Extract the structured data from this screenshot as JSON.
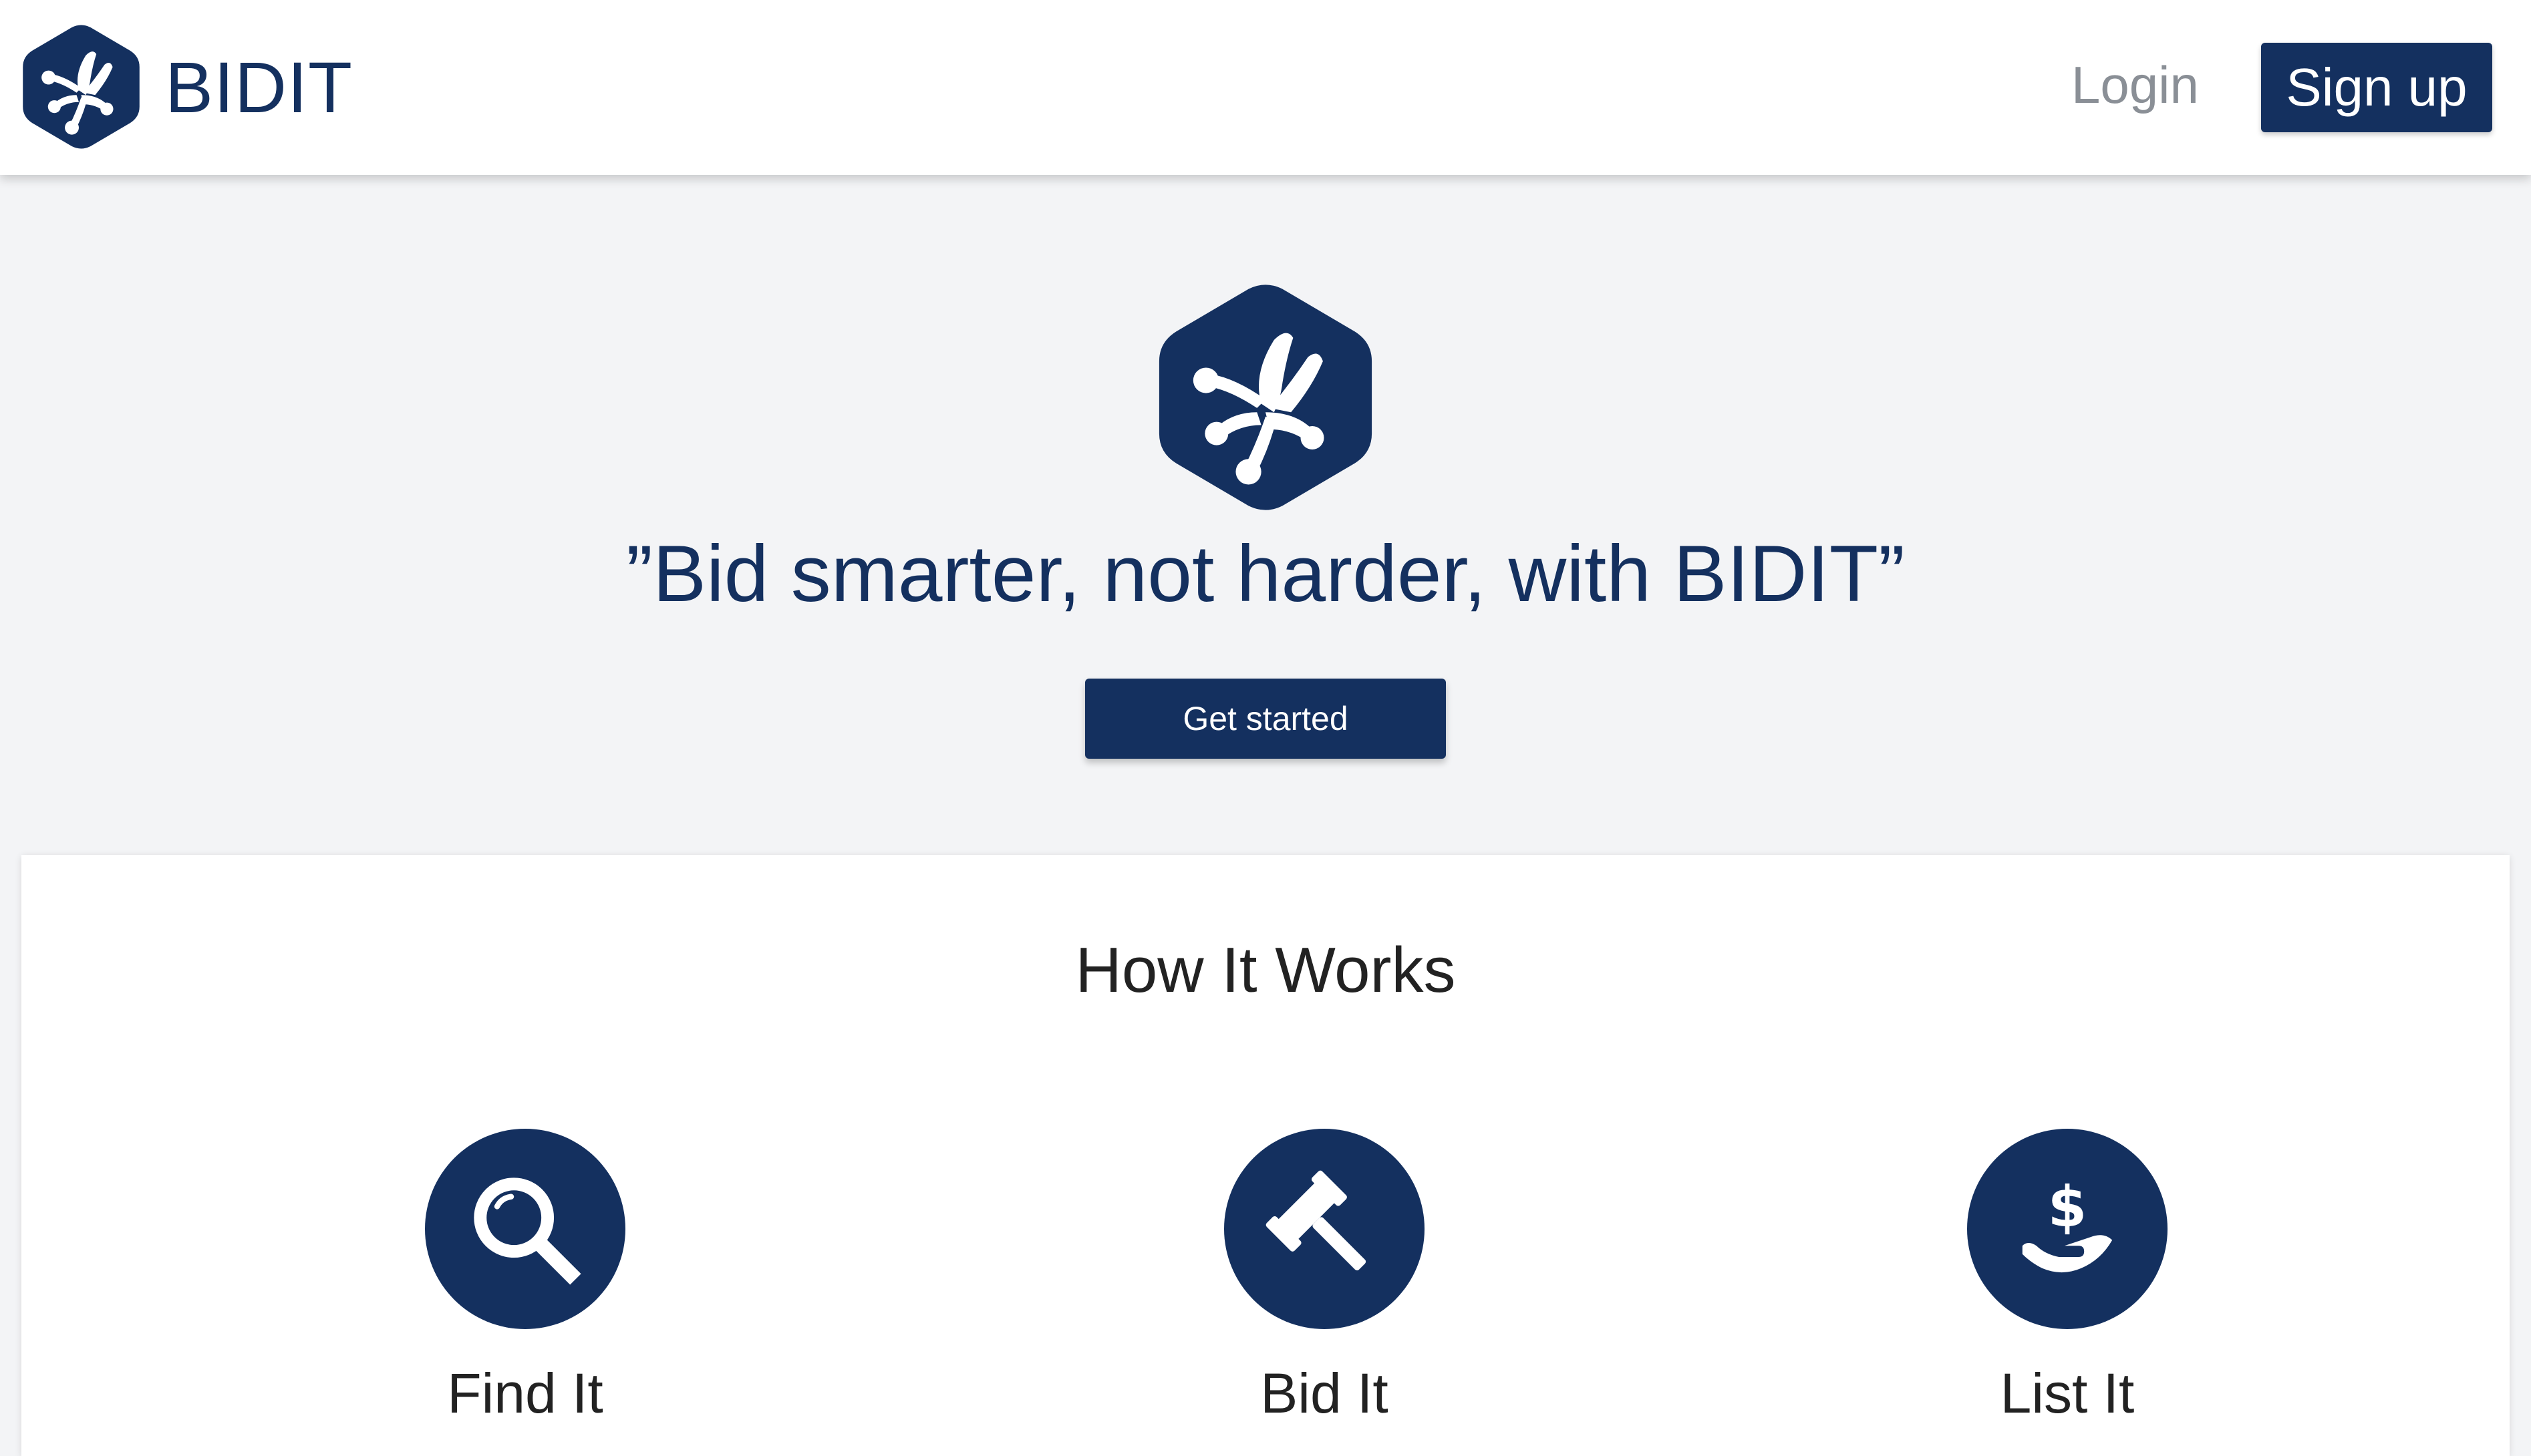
{
  "header": {
    "brand_name": "BIDIT",
    "brand_logo_icon": "frog-foot-hexagon-icon",
    "login_label": "Login",
    "signup_label": "Sign up"
  },
  "hero": {
    "logo_icon": "frog-foot-hexagon-icon",
    "tagline": "”Bid smarter, not harder, with BIDIT”",
    "cta_label": "Get started"
  },
  "how_it_works": {
    "title": "How It Works",
    "steps": [
      {
        "label": "Find It",
        "icon": "magnifier-icon"
      },
      {
        "label": "Bid It",
        "icon": "gavel-icon"
      },
      {
        "label": "List It",
        "icon": "hand-dollar-icon"
      }
    ]
  },
  "colors": {
    "brand": "#14305f",
    "page_background": "#f3f4f6",
    "card_background": "#ffffff",
    "login_text": "#8a8f96"
  }
}
